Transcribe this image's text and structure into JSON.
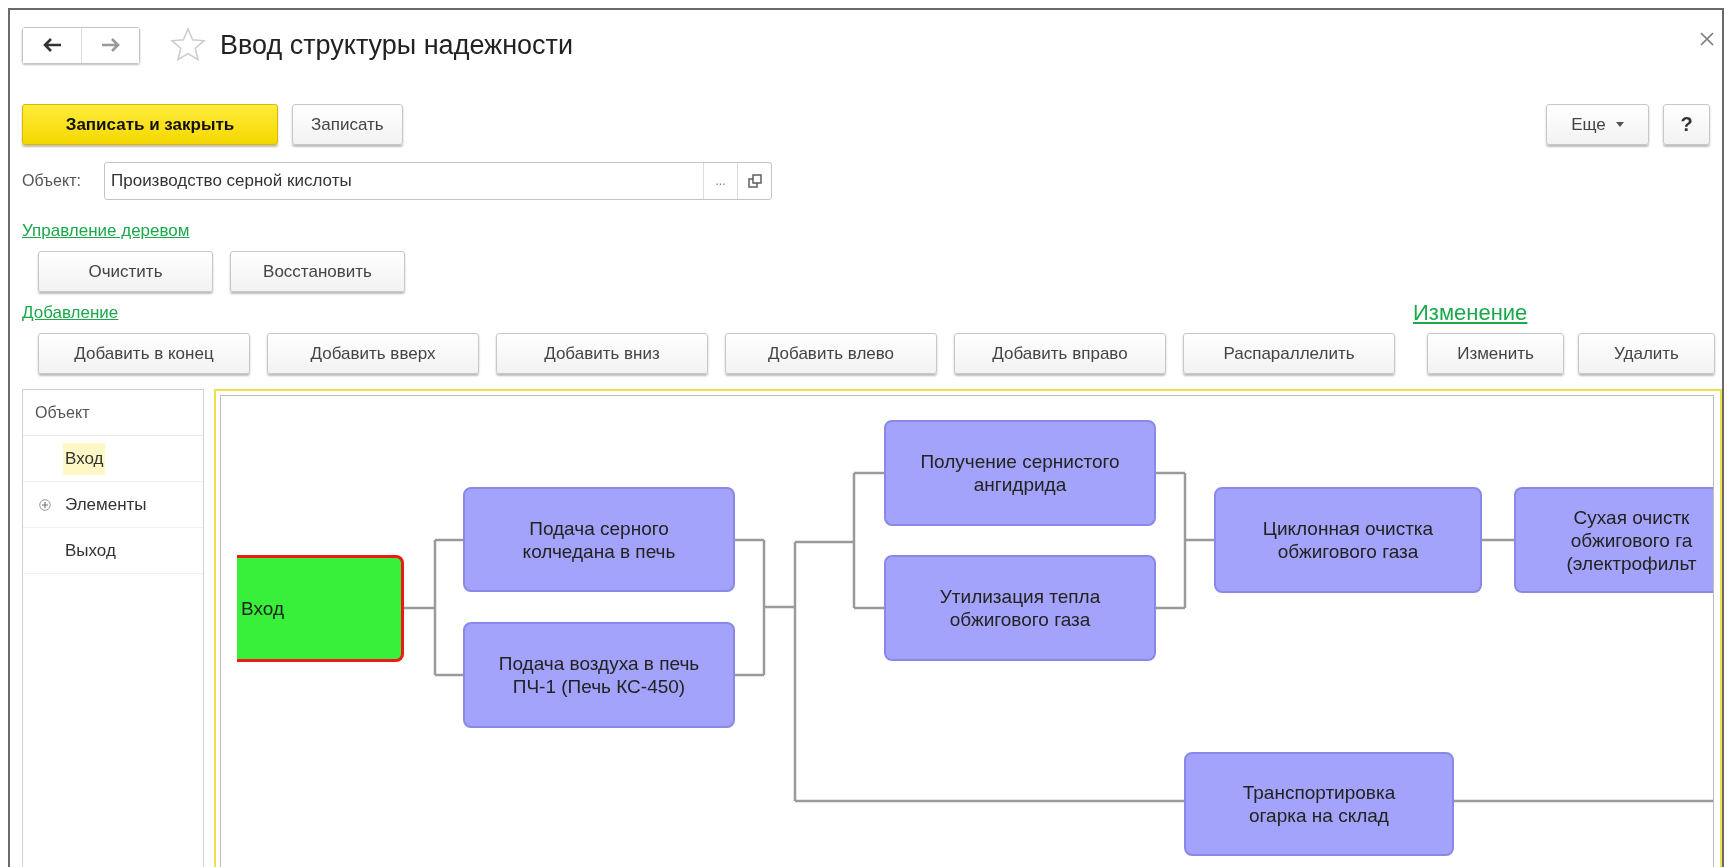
{
  "window": {
    "title": "Ввод структуры надежности"
  },
  "toolbar": {
    "buttons": [
      {
        "label": "Записать и закрыть",
        "kind": "primary"
      },
      {
        "label": "Записать",
        "kind": "default"
      }
    ],
    "more": "Еще",
    "help": "?"
  },
  "object_field": {
    "label": "Объект:",
    "value": "Производство серной кислоты",
    "select_button": "..."
  },
  "tree_group": {
    "title": "Управление деревом",
    "buttons": [
      "Очистить",
      "Восстановить"
    ]
  },
  "add_group": {
    "title": "Добавление",
    "buttons": [
      "Добавить в конец",
      "Добавить вверх",
      "Добавить вниз",
      "Добавить влево",
      "Добавить вправо",
      "Распараллелить"
    ]
  },
  "edit_group": {
    "title": "Изменение",
    "buttons": [
      "Изменить",
      "Удалить"
    ]
  },
  "tree": {
    "header": "Объект",
    "items": [
      {
        "label": "Вход",
        "selected": true
      },
      {
        "label": "Элементы",
        "selected": false,
        "expanded": false
      },
      {
        "label": "Выход",
        "selected": false
      }
    ]
  },
  "diagram": {
    "nodes": [
      {
        "kind": "input",
        "text": "Вход"
      },
      {
        "kind": "process",
        "text": "Подача серного\nколчедана в печь"
      },
      {
        "kind": "process",
        "text": "Подача воздуха в печь\nПЧ-1 (Печь КС-450)"
      },
      {
        "kind": "process",
        "text": "Получение сернистого\nангидрида"
      },
      {
        "kind": "process",
        "text": "Утилизация тепла\nобжигового газа"
      },
      {
        "kind": "process",
        "text": "Циклонная очистка\nобжигового газа"
      },
      {
        "kind": "process",
        "text": "Сухая очистк\nобжигового га\n(электрофильт"
      },
      {
        "kind": "process",
        "text": "Транспортировка\nогарка на склад"
      }
    ]
  }
}
